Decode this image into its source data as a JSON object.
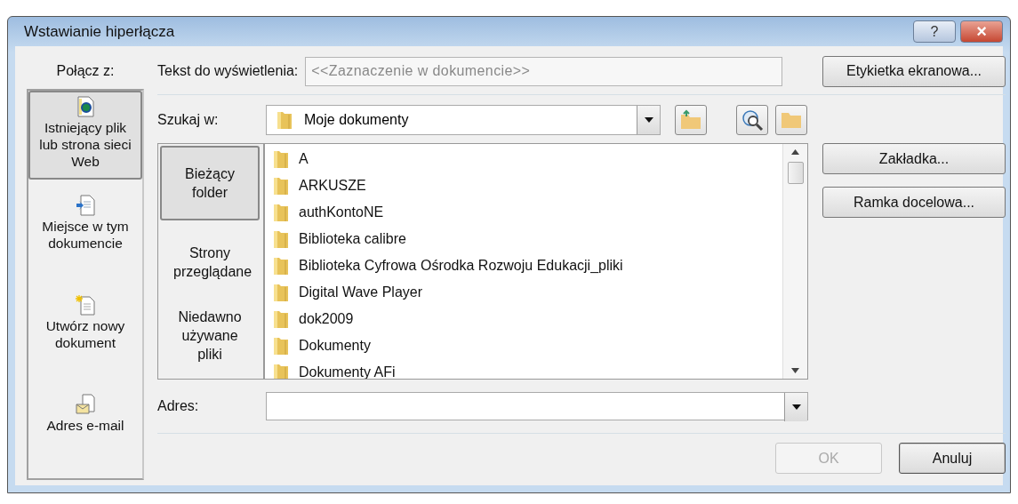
{
  "window": {
    "title": "Wstawianie hiperłącza",
    "help": "?",
    "close": "×"
  },
  "link_to": {
    "label": "Połącz z:",
    "items": [
      {
        "label": "Istniejący plik lub strona sieci Web",
        "kind": "file",
        "selected": true
      },
      {
        "label": "Miejsce w tym dokumencie",
        "kind": "place",
        "selected": false
      },
      {
        "label": "Utwórz nowy dokument",
        "kind": "new",
        "selected": false
      },
      {
        "label": "Adres e-mail",
        "kind": "mail",
        "selected": false
      }
    ]
  },
  "display_text": {
    "label": "Tekst do wyświetlenia:",
    "value": "<<Zaznaczenie w dokumencie>>",
    "disabled": true
  },
  "screen_tip_button": "Etykietka ekranowa...",
  "look_in": {
    "label": "Szukaj w:",
    "value": "Moje dokumenty"
  },
  "places": [
    {
      "label": "Bieżący folder",
      "selected": true
    },
    {
      "label": "Strony przeglądane",
      "selected": false
    },
    {
      "label": "Niedawno używane pliki",
      "selected": false
    }
  ],
  "files": [
    "A",
    "ARKUSZE",
    "authKontoNE",
    "Biblioteka calibre",
    "Biblioteka Cyfrowa Ośrodka Rozwoju Edukacji_pliki",
    "Digital Wave Player",
    "dok2009",
    "Dokumenty",
    "Dokumenty AFi"
  ],
  "side_buttons": [
    "Zakładka...",
    "Ramka docelowa..."
  ],
  "address": {
    "label": "Adres:"
  },
  "buttons": [
    {
      "label": "OK",
      "disabled": true
    },
    {
      "label": "Anuluj",
      "disabled": false
    }
  ]
}
